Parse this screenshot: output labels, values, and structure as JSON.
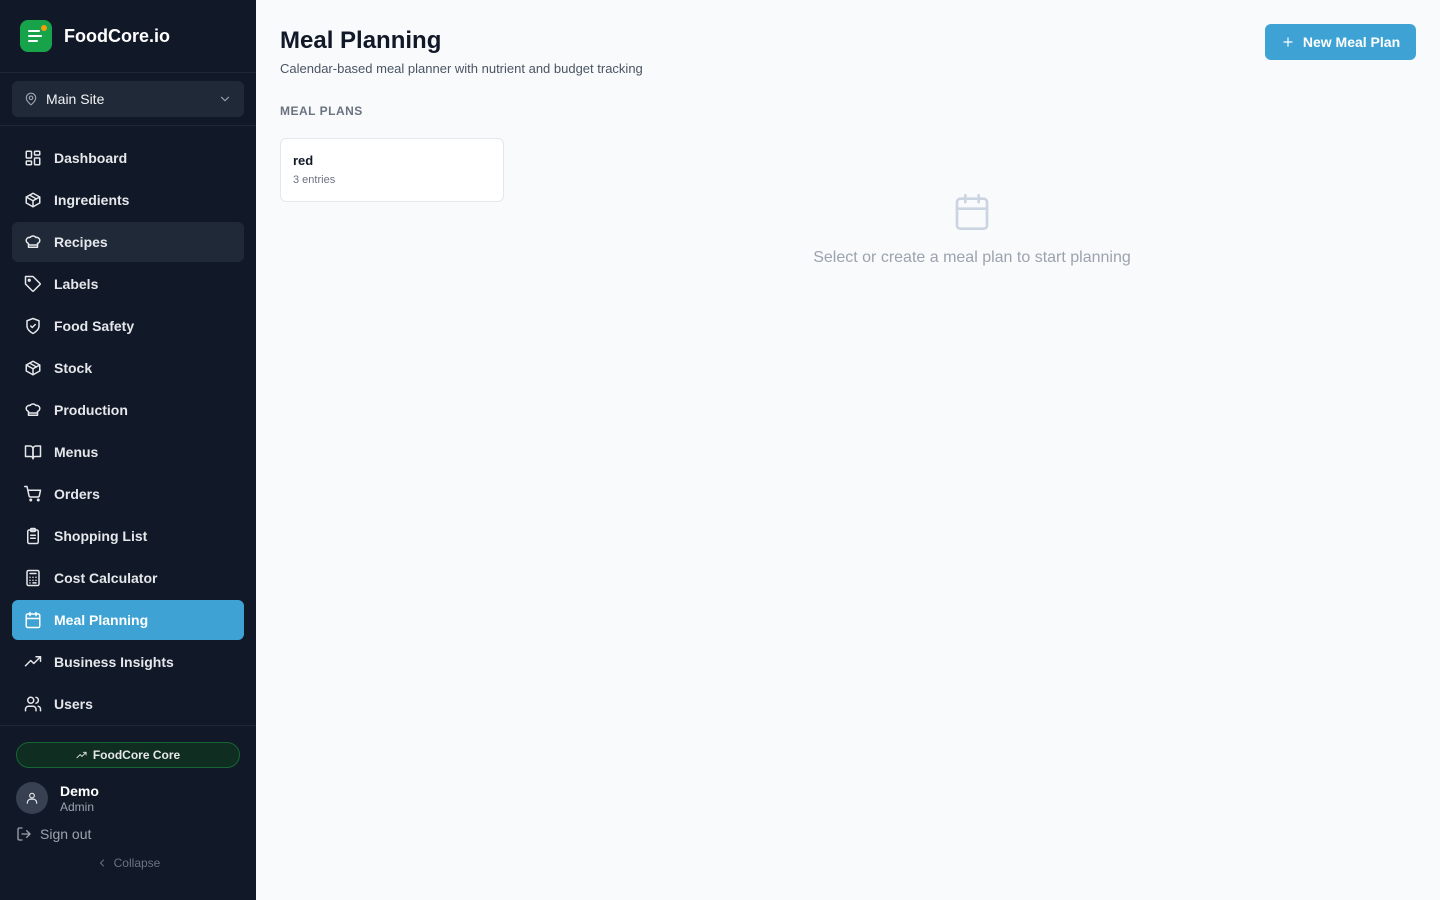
{
  "app": {
    "name": "FoodCore.io",
    "site": "Main Site"
  },
  "sidebar": {
    "items": [
      {
        "label": "Dashboard",
        "icon": "dashboard-icon"
      },
      {
        "label": "Ingredients",
        "icon": "package-icon"
      },
      {
        "label": "Recipes",
        "icon": "chef-hat-icon"
      },
      {
        "label": "Labels",
        "icon": "tag-icon"
      },
      {
        "label": "Food Safety",
        "icon": "shield-check-icon"
      },
      {
        "label": "Stock",
        "icon": "package-icon"
      },
      {
        "label": "Production",
        "icon": "chef-hat-icon"
      },
      {
        "label": "Menus",
        "icon": "book-open-icon"
      },
      {
        "label": "Orders",
        "icon": "cart-icon"
      },
      {
        "label": "Shopping List",
        "icon": "clipboard-icon"
      },
      {
        "label": "Cost Calculator",
        "icon": "calculator-icon"
      },
      {
        "label": "Meal Planning",
        "icon": "calendar-icon"
      },
      {
        "label": "Business Insights",
        "icon": "trending-up-icon"
      },
      {
        "label": "Users",
        "icon": "users-icon"
      }
    ],
    "active_item": "Meal Planning",
    "hovered_item": "Recipes",
    "plan_badge": "FoodCore Core",
    "user": {
      "name": "Demo",
      "role": "Admin"
    },
    "sign_out": "Sign out",
    "collapse": "Collapse"
  },
  "main": {
    "title": "Meal Planning",
    "subtitle": "Calendar-based meal planner with nutrient and budget tracking",
    "new_button": "New Meal Plan",
    "section_label": "MEAL PLANS",
    "plans": [
      {
        "name": "red",
        "entries": "3 entries"
      }
    ],
    "empty_message": "Select or create a meal plan to start planning"
  },
  "colors": {
    "sidebar_bg": "#111827",
    "accent": "#3ea3d4",
    "brand": "#16a34a",
    "page_bg": "#f8fafc"
  }
}
